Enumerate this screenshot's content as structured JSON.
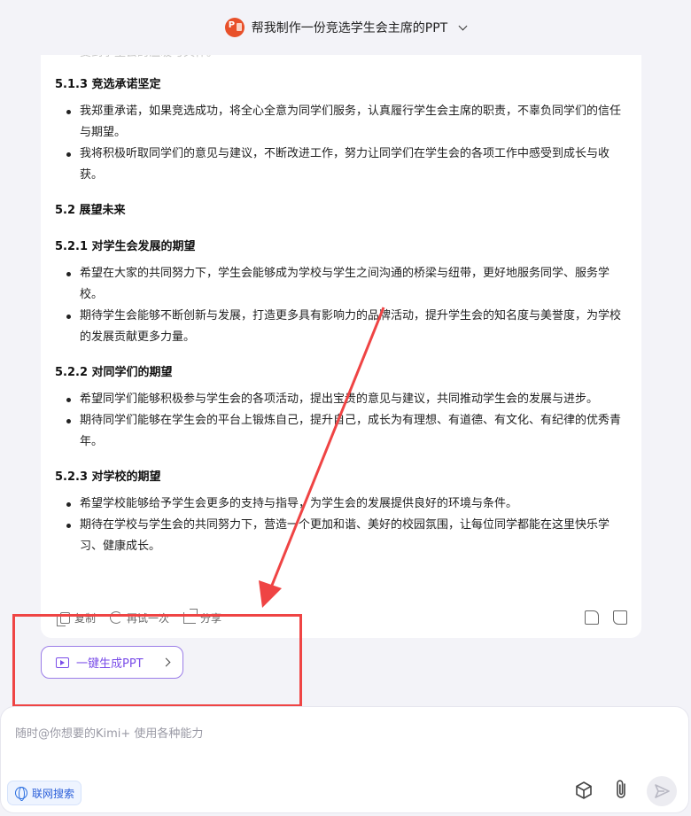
{
  "header": {
    "title": "帮我制作一份竞选学生会主席的PPT"
  },
  "message": {
    "faded_top_line": "受到学生会的温暖与关怀。",
    "sections": [
      {
        "heading": "5.1.3 竞选承诺坚定",
        "items": [
          "我郑重承诺，如果竞选成功，将全心全意为同学们服务，认真履行学生会主席的职责，不辜负同学们的信任与期望。",
          "我将积极听取同学们的意见与建议，不断改进工作，努力让同学们在学生会的各项工作中感受到成长与收获。"
        ]
      },
      {
        "heading": "5.2 展望未来",
        "items": []
      },
      {
        "heading": "5.2.1 对学生会发展的期望",
        "items": [
          "希望在大家的共同努力下，学生会能够成为学校与学生之间沟通的桥梁与纽带，更好地服务同学、服务学校。",
          "期待学生会能够不断创新与发展，打造更多具有影响力的品牌活动，提升学生会的知名度与美誉度，为学校的发展贡献更多力量。"
        ]
      },
      {
        "heading": "5.2.2 对同学们的期望",
        "items": [
          "希望同学们能够积极参与学生会的各项活动，提出宝贵的意见与建议，共同推动学生会的发展与进步。",
          "期待同学们能够在学生会的平台上锻炼自己，提升自己，成长为有理想、有道德、有文化、有纪律的优秀青年。"
        ]
      },
      {
        "heading": "5.2.3 对学校的期望",
        "items": [
          "希望学校能够给予学生会更多的支持与指导，为学生会的发展提供良好的环境与条件。",
          "期待在学校与学生会的共同努力下，营造一个更加和谐、美好的校园氛围，让每位同学都能在这里快乐学习、健康成长。"
        ]
      }
    ],
    "actions": {
      "copy": "复制",
      "retry": "再试一次",
      "share": "分享"
    }
  },
  "generate_button": {
    "label": "一键生成PPT"
  },
  "input": {
    "placeholder": "随时@你想要的Kimi+ 使用各种能力",
    "web_search_label": "联网搜索"
  },
  "colors": {
    "accent_purple": "#7a4de8",
    "annotation_red": "#ef4444",
    "link_blue": "#2b5fd9"
  }
}
